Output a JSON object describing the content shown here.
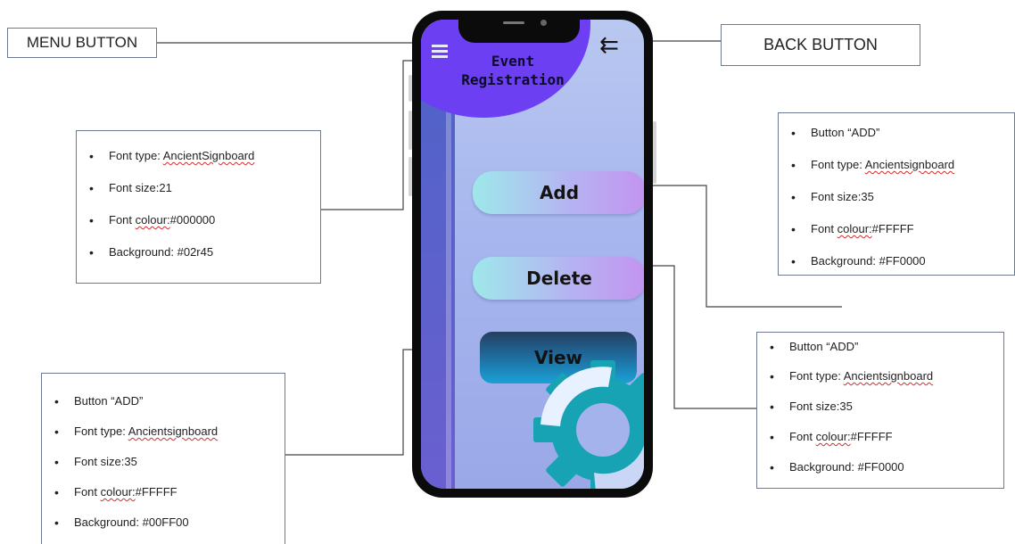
{
  "labels": {
    "menu_button": "MENU BUTTON",
    "back_button": "BACK BUTTON"
  },
  "phone": {
    "title_line1": "Event",
    "title_line2": "Registration",
    "buttons": {
      "add": "Add",
      "delete": "Delete",
      "view": "View"
    }
  },
  "notes": {
    "title_note": [
      {
        "prefix": "Font type:  ",
        "squiggle": "AncientSignboard"
      },
      {
        "prefix": "Font size:21",
        "squiggle": ""
      },
      {
        "prefix": "Font ",
        "squiggle": "colour:",
        "suffix": "#000000"
      },
      {
        "prefix": "Background: #02r45",
        "squiggle": ""
      }
    ],
    "add_note": [
      {
        "prefix": "Button “ADD”",
        "squiggle": ""
      },
      {
        "prefix": "Font type:  ",
        "squiggle": "Ancientsignboard"
      },
      {
        "prefix": "Font size:35",
        "squiggle": ""
      },
      {
        "prefix": "Font ",
        "squiggle": "colour:",
        "suffix": "#FFFFF"
      },
      {
        "prefix": "Background: #FF0000",
        "squiggle": ""
      }
    ],
    "delete_note": [
      {
        "prefix": "Button “ADD”",
        "squiggle": ""
      },
      {
        "prefix": "Font type:  ",
        "squiggle": "Ancientsignboard"
      },
      {
        "prefix": "Font size:35",
        "squiggle": ""
      },
      {
        "prefix": "Font ",
        "squiggle": "colour:",
        "suffix": "#FFFFF"
      },
      {
        "prefix": "Background: #FF0000",
        "squiggle": ""
      }
    ],
    "view_note": [
      {
        "prefix": "Button “ADD”",
        "squiggle": ""
      },
      {
        "prefix": "Font type:  ",
        "squiggle": "Ancientsignboard"
      },
      {
        "prefix": "Font size:35",
        "squiggle": ""
      },
      {
        "prefix": "Font ",
        "squiggle": "colour:",
        "suffix": "#FFFFF"
      },
      {
        "prefix": "Background: #00FF00",
        "squiggle": ""
      }
    ]
  },
  "icons": {
    "menu": "hamburger-menu-icon",
    "back": "back-arrow-icon",
    "gear": "gear-icon"
  },
  "colors": {
    "screen_blob": "#6d3ff2",
    "view_button": "#1f6696",
    "gear": "#17a3b3"
  }
}
